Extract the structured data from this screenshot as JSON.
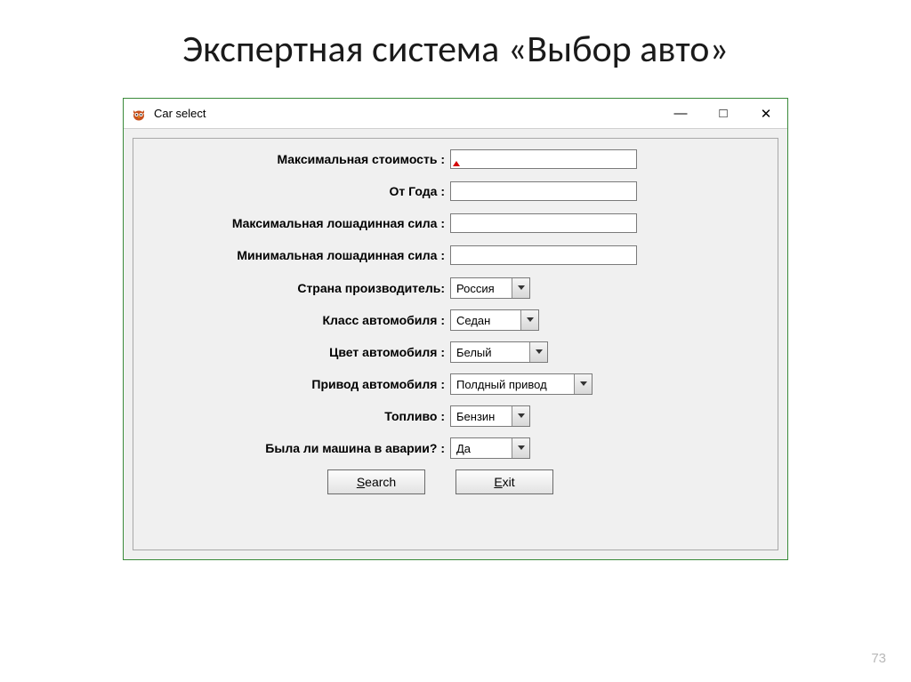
{
  "slide": {
    "title": "Экспертная система «Выбор авто»",
    "page_number": "73"
  },
  "window": {
    "title": "Car select",
    "icon": "owl-icon",
    "controls": {
      "minimize": "—",
      "maximize": "□",
      "close": "✕"
    }
  },
  "form": {
    "max_price": {
      "label": "Максимальная стоимость :",
      "value": ""
    },
    "from_year": {
      "label": "От Года :",
      "value": ""
    },
    "max_hp": {
      "label": "Максимальная лошадинная сила :",
      "value": ""
    },
    "min_hp": {
      "label": "Минимальная лошадинная сила :",
      "value": ""
    },
    "country": {
      "label": "Страна производитель:",
      "value": "Россия"
    },
    "class": {
      "label": "Класс автомобиля :",
      "value": "Седан"
    },
    "color": {
      "label": "Цвет автомобиля :",
      "value": "Белый"
    },
    "drive": {
      "label": "Привод автомобиля :",
      "value": "Полдный привод"
    },
    "fuel": {
      "label": "Топливо :",
      "value": "Бензин"
    },
    "accident": {
      "label": "Была ли машина в аварии? :",
      "value": "Да"
    }
  },
  "buttons": {
    "search": {
      "mnemonic": "S",
      "rest": "earch"
    },
    "exit": {
      "mnemonic": "E",
      "rest": "xit"
    }
  }
}
